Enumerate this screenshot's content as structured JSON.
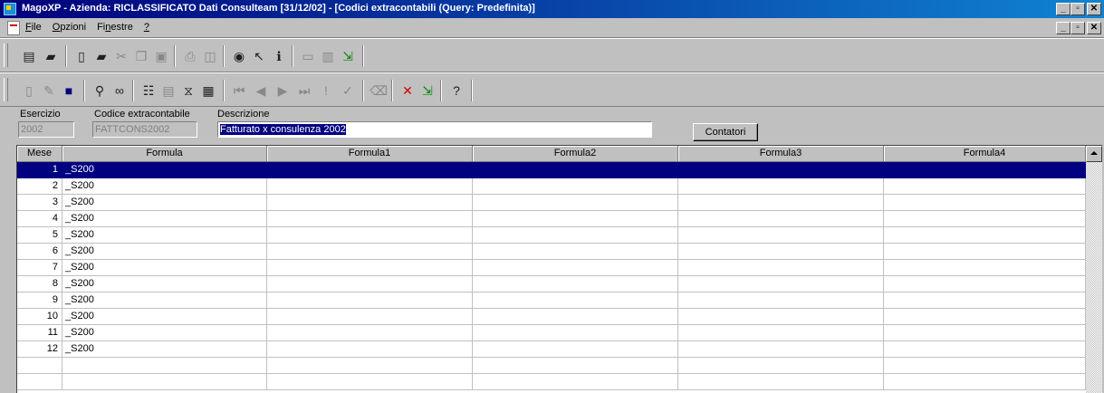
{
  "window": {
    "title": "MagoXP  - Azienda: RICLASSIFICATO Dati Consulteam [31/12/02] - [Codici extracontabili (Query: Predefinita)]"
  },
  "menu": {
    "items": [
      "File",
      "Opzioni",
      "Finestre",
      "?"
    ]
  },
  "toolbar1": {
    "icons": [
      "new-icon",
      "open-icon",
      "new-doc-icon",
      "open-folder-icon",
      "cut-icon",
      "copy-icon",
      "paste-icon",
      "print-icon",
      "print-preview-icon",
      "camera-icon",
      "help-pointer-icon",
      "info-icon",
      "image-icon",
      "columns-icon",
      "exit-icon"
    ]
  },
  "toolbar2": {
    "icons": [
      "new-record-icon",
      "edit-icon",
      "save-icon",
      "search-icon",
      "binoculars-icon",
      "properties-icon",
      "document-icon",
      "filter-icon",
      "form-icon",
      "first-record-icon",
      "prev-record-icon",
      "next-record-icon",
      "last-record-icon",
      "exclamation-icon",
      "check-icon",
      "delete-icon",
      "cancel-icon",
      "exit-icon",
      "help-icon"
    ]
  },
  "form": {
    "esercizio_label": "Esercizio",
    "esercizio_value": "2002",
    "codice_label": "Codice extracontabile",
    "codice_value": "FATTCONS2002",
    "descrizione_label": "Descrizione",
    "descrizione_value": "Fatturato x consulenza 2002",
    "contatori_label": "Contatori"
  },
  "grid": {
    "columns": [
      "Mese",
      "Formula",
      "Formula1",
      "Formula2",
      "Formula3",
      "Formula4"
    ],
    "rows": [
      {
        "mese": "1",
        "formula": "_S200"
      },
      {
        "mese": "2",
        "formula": "_S200"
      },
      {
        "mese": "3",
        "formula": "_S200"
      },
      {
        "mese": "4",
        "formula": "_S200"
      },
      {
        "mese": "5",
        "formula": "_S200"
      },
      {
        "mese": "6",
        "formula": "_S200"
      },
      {
        "mese": "7",
        "formula": "_S200"
      },
      {
        "mese": "8",
        "formula": "_S200"
      },
      {
        "mese": "9",
        "formula": "_S200"
      },
      {
        "mese": "10",
        "formula": "_S200"
      },
      {
        "mese": "11",
        "formula": "_S200"
      },
      {
        "mese": "12",
        "formula": "_S200"
      }
    ],
    "selected_row": 1
  }
}
